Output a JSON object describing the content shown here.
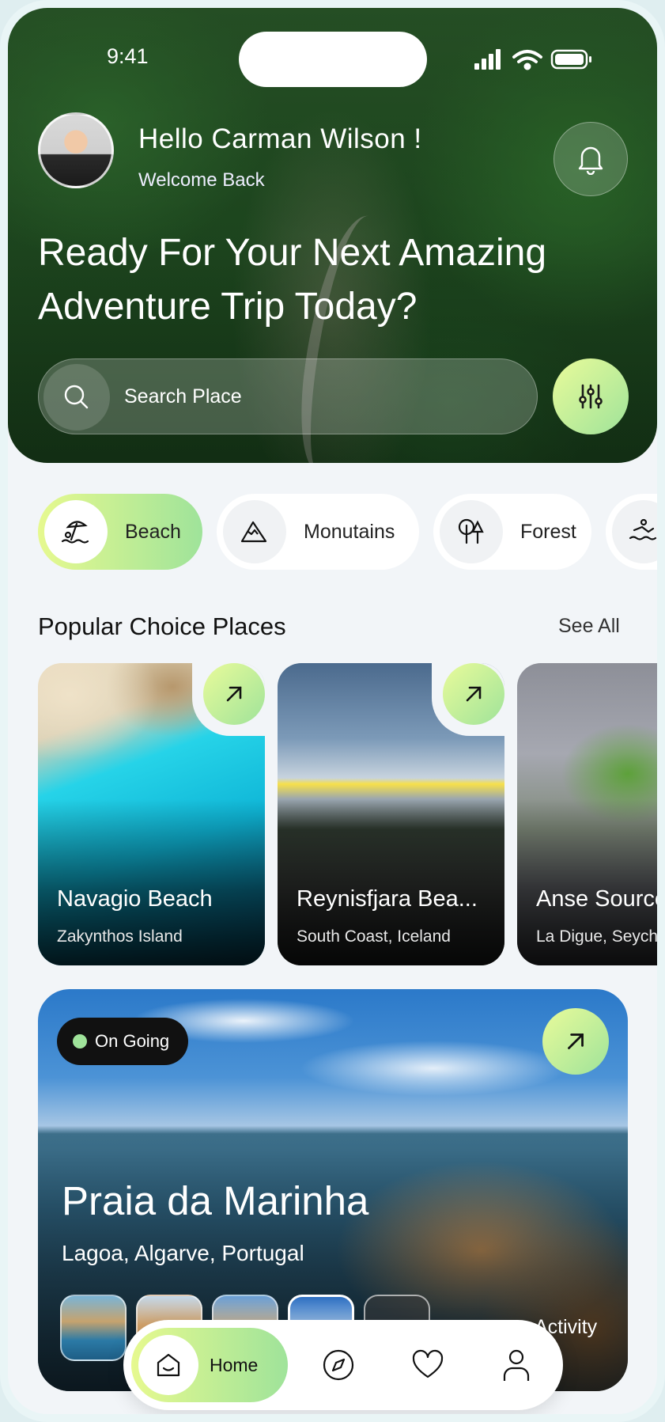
{
  "status": {
    "time": "9:41"
  },
  "header": {
    "greeting": "Hello Carman Wilson !",
    "subtitle": "Welcome Back",
    "headline_line1": "Ready For Your Next Amazing",
    "headline_line2": "Adventure Trip Today?"
  },
  "search": {
    "placeholder": "Search Place"
  },
  "categories": [
    {
      "label": "Beach",
      "icon": "beach-umbrella-icon",
      "active": true
    },
    {
      "label": "Monutains",
      "icon": "mountain-icon",
      "active": false
    },
    {
      "label": "Forest",
      "icon": "tree-icon",
      "active": false
    },
    {
      "label": "",
      "icon": "swimmer-icon",
      "active": false
    }
  ],
  "popular": {
    "title": "Popular Choice Places",
    "see_all": "See All",
    "places": [
      {
        "name": "Navagio Beach",
        "location": "Zakynthos Island"
      },
      {
        "name": "Reynisfjara Bea...",
        "location": "South Coast, Iceland"
      },
      {
        "name": "Anse Source",
        "location": "La Digue, Seychelles"
      }
    ]
  },
  "featured": {
    "badge": "On Going",
    "title": "Praia da Marinha",
    "location": "Lagoa, Algarve, Portugal",
    "activity_label": "Activity"
  },
  "nav": {
    "home_label": "Home",
    "items": [
      "home-icon",
      "compass-icon",
      "heart-icon",
      "user-icon"
    ]
  },
  "colors": {
    "accent_start": "#e6f98f",
    "accent_end": "#9fe39a",
    "background": "#f2f5f8"
  }
}
